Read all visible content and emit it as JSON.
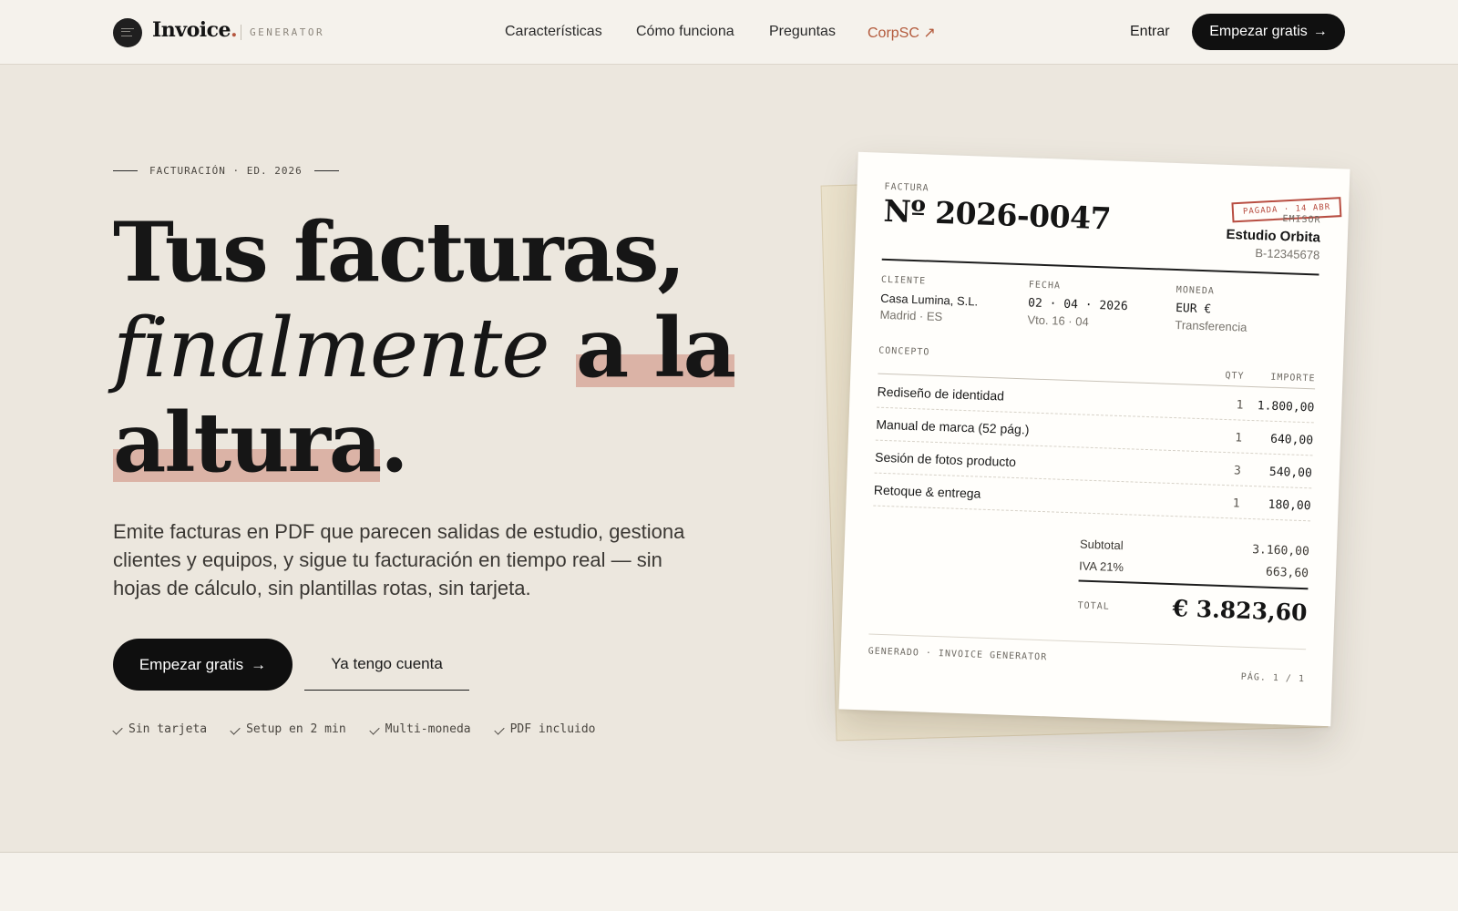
{
  "brand": {
    "name": "Invoice",
    "dot": ".",
    "tagline": "GENERATOR",
    "accent": "#b5563f"
  },
  "nav": {
    "links": [
      {
        "label": "Características"
      },
      {
        "label": "Cómo funciona"
      },
      {
        "label": "Preguntas"
      },
      {
        "label": "CorpSC ↗"
      }
    ],
    "login": "Entrar",
    "cta": "Empezar gratis",
    "cta_arrow": "→"
  },
  "hero": {
    "eyebrow": "FACTURACIÓN · ED. 2026",
    "title_line1": "Tus facturas,",
    "title_italic": "finalmente",
    "title_highlight1": "a la",
    "title_highlight2": "altura",
    "title_end": ".",
    "lede": "Emite facturas en PDF que parecen salidas de estudio, gestiona clientes y equipos, y sigue tu facturación en tiempo real — sin hojas de cálculo, sin plantillas rotas, sin tarjeta.",
    "primary_cta": "Empezar gratis",
    "primary_arrow": "→",
    "secondary_cta": "Ya tengo cuenta",
    "highlight_color": "#dbb3a6",
    "perks": [
      "Sin tarjeta",
      "Setup en 2 min",
      "Multi-moneda",
      "PDF incluido"
    ]
  },
  "invoice": {
    "doc_label": "FACTURA",
    "number": "Nº 2026-0047",
    "stamp": "PAGADA · 14 ABR",
    "stamp_color": "#b84e42",
    "issuer_label": "EMISOR",
    "issuer_name": "Estudio Orbita",
    "issuer_tax": "B-12345678",
    "client_label": "CLIENTE",
    "client_name": "Casa Lumina, S.L.",
    "client_city": "Madrid · ES",
    "date_label": "FECHA",
    "date_value": "02 · 04 · 2026",
    "due": "Vto. 16 · 04",
    "currency_label": "MONEDA",
    "currency_value": "EUR €",
    "payment": "Transferencia",
    "col_concept": "CONCEPTO",
    "col_qty": "QTY",
    "col_amount": "IMPORTE",
    "items": [
      {
        "desc": "Rediseño de identidad",
        "qty": "1",
        "amount": "1.800,00"
      },
      {
        "desc": "Manual de marca (52 pág.)",
        "qty": "1",
        "amount": "640,00"
      },
      {
        "desc": "Sesión de fotos producto",
        "qty": "3",
        "amount": "540,00"
      },
      {
        "desc": "Retoque & entrega",
        "qty": "1",
        "amount": "180,00"
      }
    ],
    "subtotal_label": "Subtotal",
    "subtotal": "3.160,00",
    "tax_label": "IVA 21%",
    "tax": "663,60",
    "total_label": "TOTAL",
    "total": "€ 3.823,60",
    "footer_left": "GENERADO · INVOICE GENERATOR",
    "footer_right": "PÁG. 1 / 1"
  }
}
